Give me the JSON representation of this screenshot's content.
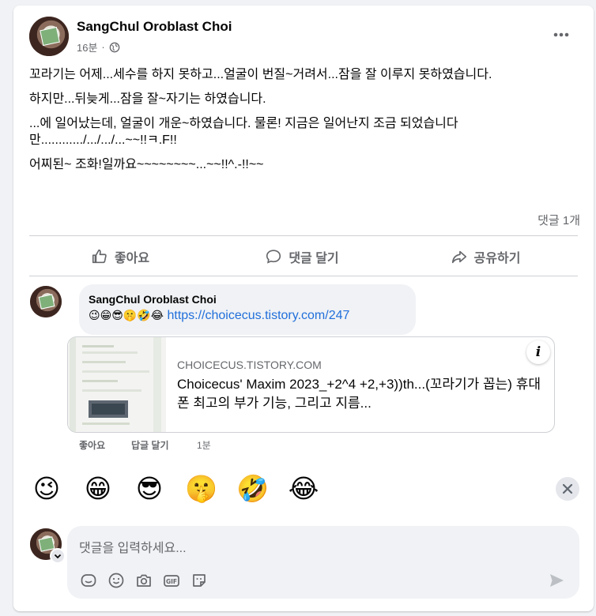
{
  "post": {
    "author": "SangChul Oroblast Choi",
    "time": "16분",
    "separator": "·",
    "paragraphs": [
      "꼬라기는 어제...세수를 하지 못하고...얼굴이 번질~거려서...잠을 잘 이루지 못하였습니다.",
      "하지만...뒤늦게...잠을 잘~자기는 하였습니다.",
      "...에 일어났는데, 얼굴이 개운~하였습니다. 물론! 지금은 일어난지 조금 되었습니다만............/.../.../...~~!!ㅋ.F!!",
      "어찌된~ 조화!일까요~~~~~~~~...~~!!^.-!!~~"
    ],
    "comment_count": "댓글 1개"
  },
  "actions": {
    "like": "좋아요",
    "comment": "댓글 달기",
    "share": "공유하기"
  },
  "comment": {
    "author": "SangChul Oroblast Choi",
    "emojis": "😉😁😎🤫🤣😂",
    "link_text": "https://choicecus.tistory.com/247",
    "preview_domain": "CHOICECUS.TISTORY.COM",
    "preview_title": "Choicecus' Maxim 2023_+2^4 +2,+3))th...(꼬라기가 꼽는) 휴대폰 최고의 부가 기능, 그리고 지름...",
    "like_label": "좋아요",
    "reply_label": "답글 달기",
    "time": "1분"
  },
  "emoji_bar": [
    "😉",
    "😁",
    "😎",
    "🤫",
    "🤣",
    "😂"
  ],
  "composer": {
    "placeholder": "댓글을 입력하세요..."
  },
  "colors": {
    "link": "#216fdb",
    "secondary_text": "#65676b",
    "background": "#f0f2f5"
  }
}
